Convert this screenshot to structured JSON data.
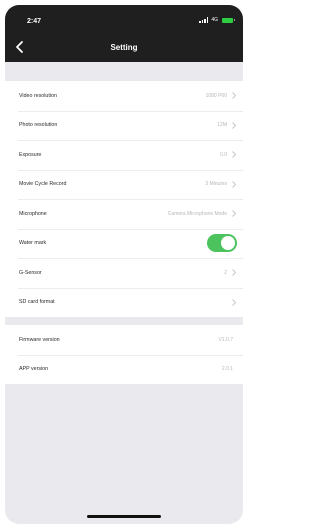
{
  "status_bar": {
    "time": "2:47",
    "network": "4G"
  },
  "header": {
    "title": "Setting"
  },
  "settings": [
    {
      "label": "Video resolution",
      "value": "1080 P60"
    },
    {
      "label": "Photo resolution",
      "value": "12M"
    },
    {
      "label": "Exposure",
      "value": "0.0"
    },
    {
      "label": "Movie Cycle Record",
      "value": "3 Minutes"
    },
    {
      "label": "Microphone",
      "value": "Camera Microphone Mode"
    },
    {
      "label": "Water mark",
      "toggle_on": true
    },
    {
      "label": "G-Sensor",
      "value": "2"
    },
    {
      "label": "SD card format",
      "value": ""
    }
  ],
  "info": [
    {
      "label": "Firmware version",
      "value": "V1.0.7"
    },
    {
      "label": "APP version",
      "value": "2.0.1"
    }
  ],
  "colors": {
    "header": "#1f1f1f",
    "toggle_on": "#4cc35d",
    "battery": "#2ecc40",
    "background": "#e9e9ee"
  }
}
